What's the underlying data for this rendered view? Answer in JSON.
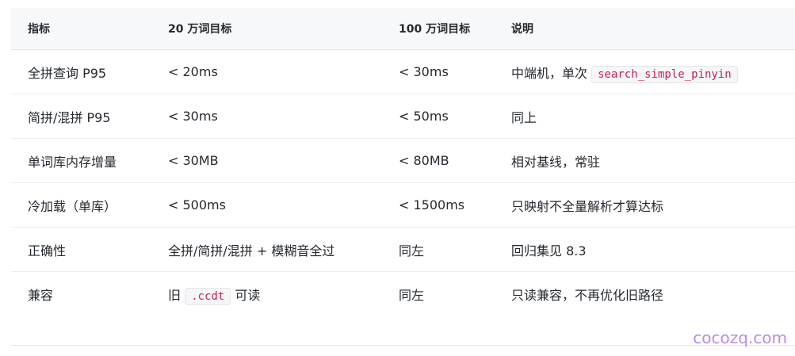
{
  "table": {
    "headers": [
      "指标",
      "20 万词目标",
      "100 万词目标",
      "说明"
    ],
    "rows": [
      {
        "metric": "全拼查询 P95",
        "target_200k": "< 20ms",
        "target_1m": "< 30ms",
        "note_prefix": "中端机，单次 ",
        "note_code": "search_simple_pinyin",
        "note_suffix": ""
      },
      {
        "metric": "简拼/混拼 P95",
        "target_200k": "< 30ms",
        "target_1m": "< 50ms",
        "note_prefix": "同上",
        "note_code": "",
        "note_suffix": ""
      },
      {
        "metric": "单词库内存增量",
        "target_200k": "< 30MB",
        "target_1m": "< 80MB",
        "note_prefix": "相对基线，常驻",
        "note_code": "",
        "note_suffix": ""
      },
      {
        "metric": "冷加载（单库）",
        "target_200k": "< 500ms",
        "target_1m": "< 1500ms",
        "note_prefix": "只映射不全量解析才算达标",
        "note_code": "",
        "note_suffix": ""
      },
      {
        "metric": "正确性",
        "target_200k": "全拼/简拼/混拼 + 模糊音全过",
        "target_1m": "同左",
        "note_prefix": "回归集见 8.3",
        "note_code": "",
        "note_suffix": ""
      },
      {
        "metric": "兼容",
        "target_200k_prefix": "旧 ",
        "target_200k_code": ".ccdt",
        "target_200k_suffix": " 可读",
        "target_1m": "同左",
        "note_prefix": "只读兼容，不再优化旧路径",
        "note_code": "",
        "note_suffix": ""
      }
    ]
  },
  "watermark": "cocozq.com"
}
